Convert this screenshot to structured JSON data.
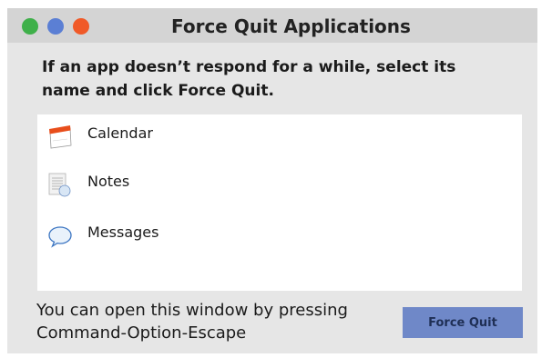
{
  "window": {
    "title": "Force Quit Applications",
    "traffic_lights": [
      {
        "name": "close",
        "color": "#3fb04a"
      },
      {
        "name": "minimize",
        "color": "#5b7fd4"
      },
      {
        "name": "zoom",
        "color": "#f05a28"
      }
    ]
  },
  "instruction": "If an app doesn’t respond for a while, select its name and click Force Quit.",
  "apps": [
    {
      "label": "Calendar",
      "icon": "calendar-icon"
    },
    {
      "label": "Notes",
      "icon": "notes-icon"
    },
    {
      "label": "Messages",
      "icon": "messages-icon"
    }
  ],
  "footer": {
    "hint": "You can open this window by pressing Command-Option-Escape",
    "button_label": "Force Quit"
  },
  "colors": {
    "titlebar": "#d4d4d4",
    "window_bg": "#e6e6e6",
    "button": "#6f88c8",
    "button_text": "#1f2f55",
    "calendar_accent": "#e84e1b"
  }
}
